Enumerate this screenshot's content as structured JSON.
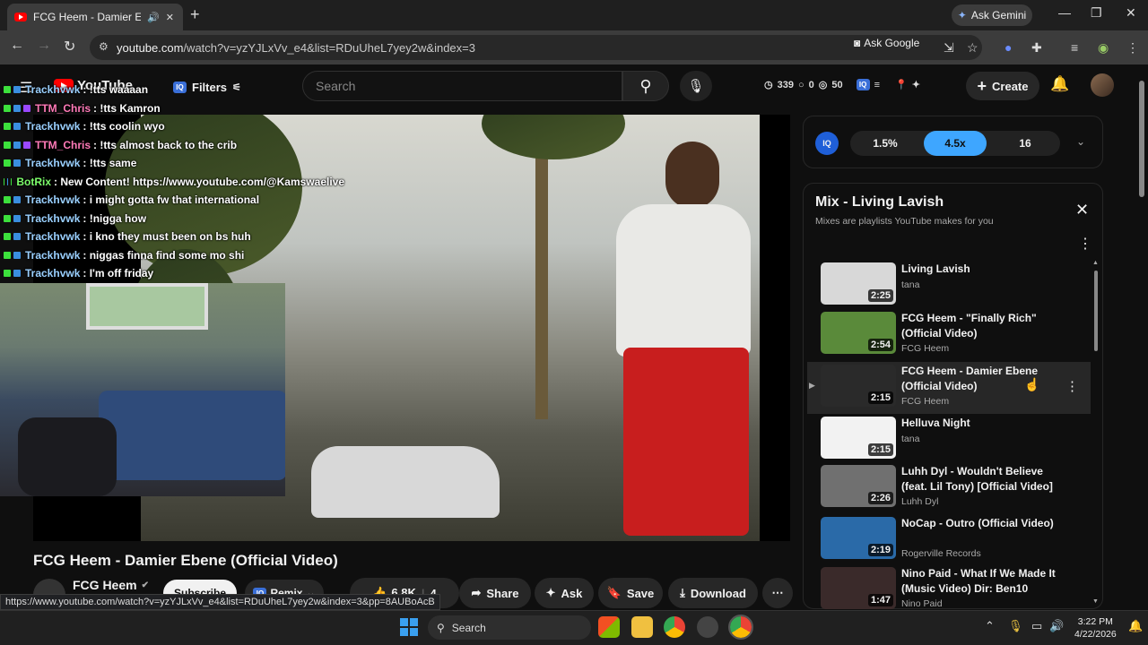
{
  "browser": {
    "tab_title": "FCG Heem - Damier Ebene",
    "new_tab": "+",
    "gemini": "Ask Gemini",
    "url_host": "youtube.com",
    "url_path": "/watch?v=yzYJLxVv_e4&list=RDuUheL7yey2w&index=3",
    "ask_google": "Ask Google",
    "status_url": "https://www.youtube.com/watch?v=yzYJLxVv_e4&list=RDuUheL7yey2w&index=3&pp=8AUBoAcB"
  },
  "youtube": {
    "logo": "YouTube",
    "filters": "Filters",
    "iq": "IQ",
    "search_placeholder": "Search",
    "stats": {
      "a": "339",
      "b": "0",
      "c": "50"
    },
    "create": "Create"
  },
  "chat": [
    {
      "user": "Trackhvwk",
      "msg": ": !tts waaaan",
      "color": "#9ad0ff",
      "badges": [
        "green",
        "blue"
      ]
    },
    {
      "user": "TTM_Chris",
      "msg": ": !tts Kamron",
      "color": "#ff7ab8",
      "badges": [
        "green",
        "blue",
        "purple"
      ]
    },
    {
      "user": "Trackhvwk",
      "msg": ": !tts coolin wyo",
      "color": "#9ad0ff",
      "badges": [
        "green",
        "blue"
      ]
    },
    {
      "user": "TTM_Chris",
      "msg": ": !tts almost back to the crib",
      "color": "#ff7ab8",
      "badges": [
        "green",
        "blue",
        "purple"
      ]
    },
    {
      "user": "Trackhvwk",
      "msg": ": !tts same",
      "color": "#9ad0ff",
      "badges": [
        "green",
        "blue"
      ]
    },
    {
      "user": "BotRix",
      "msg": ": New Content! https://www.youtube.com/@Kamswaelive",
      "color": "#7CFC6A",
      "badges": [
        "green",
        "blue",
        "green"
      ]
    },
    {
      "user": "Trackhvwk",
      "msg": ": i might gotta fw that international",
      "color": "#9ad0ff",
      "badges": [
        "green",
        "blue"
      ]
    },
    {
      "user": "Trackhvwk",
      "msg": ": !nigga how",
      "color": "#9ad0ff",
      "badges": [
        "green",
        "blue"
      ]
    },
    {
      "user": "Trackhvwk",
      "msg": ": i kno they must been on bs huh",
      "color": "#9ad0ff",
      "badges": [
        "green",
        "blue"
      ]
    },
    {
      "user": "Trackhvwk",
      "msg": ": niggas finna find some mo shi",
      "color": "#9ad0ff",
      "badges": [
        "green",
        "blue"
      ]
    },
    {
      "user": "Trackhvwk",
      "msg": ": I'm off friday",
      "color": "#9ad0ff",
      "badges": [
        "green",
        "blue"
      ]
    }
  ],
  "video": {
    "title": "FCG Heem - Damier Ebene (Official Video)",
    "channel": "FCG Heem",
    "subscribe": "Subscribe",
    "remix": "Remix",
    "likes": "6.8K",
    "comments": "4",
    "share": "Share",
    "ask": "Ask",
    "save": "Save",
    "download": "Download"
  },
  "controls": {
    "iq": "IQ",
    "seg1": "1.5%",
    "seg2": "4.5x",
    "seg3": "16"
  },
  "playlist": {
    "title": "Mix - Living Lavish",
    "subtitle": "Mixes are playlists YouTube makes for you",
    "items": [
      {
        "title": "Living Lavish",
        "channel": "tana",
        "duration": "2:25"
      },
      {
        "title": "FCG Heem - \"Finally Rich\" (Official Video)",
        "channel": "FCG Heem",
        "duration": "2:54"
      },
      {
        "title": "FCG Heem - Damier Ebene (Official Video)",
        "channel": "FCG Heem",
        "duration": "2:15"
      },
      {
        "title": "Helluva Night",
        "channel": "tana",
        "duration": "2:15"
      },
      {
        "title": "Luhh Dyl - Wouldn't Believe (feat. Lil Tony) [Official Video]",
        "channel": "Luhh Dyl",
        "duration": "2:26"
      },
      {
        "title": "NoCap - Outro (Official Video)",
        "channel": "Rogerville Records",
        "duration": "2:19"
      },
      {
        "title": "Nino Paid - What If We Made It (Music Video) Dir: Ben10",
        "channel": "Nino Paid",
        "duration": "1:47"
      }
    ]
  },
  "taskbar": {
    "search": "Search",
    "time": "3:22 PM",
    "date": "4/22/2026"
  }
}
